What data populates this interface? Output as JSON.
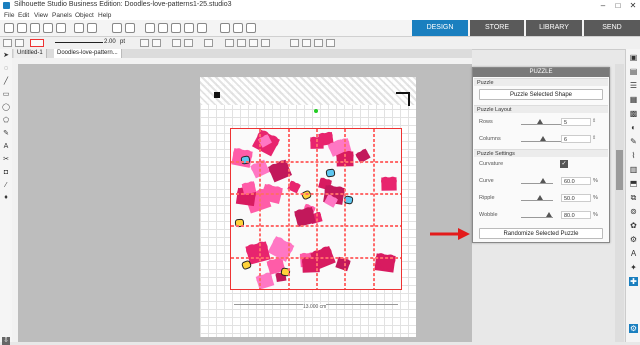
{
  "window": {
    "title": "Silhouette Studio Business Edition: Doodles-love-patterns1-25.studio3"
  },
  "menu": [
    "File",
    "Edit",
    "View",
    "Panels",
    "Object",
    "Help"
  ],
  "toolbar": {
    "line_width": "2.00",
    "line_unit": "pt"
  },
  "nav_tabs": [
    {
      "label": "DESIGN",
      "color": "#1a7fbf"
    },
    {
      "label": "STORE",
      "color": "#5a5a5a"
    },
    {
      "label": "LIBRARY",
      "color": "#5a5a5a"
    },
    {
      "label": "SEND",
      "color": "#5a5a5a"
    }
  ],
  "doc_tabs": [
    "Untitled-1",
    "Doodles-love-pattern..."
  ],
  "canvas": {
    "dimension_label": "13.000 cm",
    "accent": "#e33333"
  },
  "panel": {
    "title": "PUZZLE",
    "puzzle_section": "Puzzle",
    "puzzle_button": "Puzzle Selected Shape",
    "layout_section": "Puzzle Layout",
    "rows_label": "Rows",
    "rows_value": "5",
    "columns_label": "Columns",
    "columns_value": "6",
    "settings_section": "Puzzle Settings",
    "curvature_label": "Curvature",
    "curve_label": "Curve",
    "curve_value": "60.0",
    "ripple_label": "Ripple",
    "ripple_value": "50.0",
    "wobble_label": "Wobble",
    "wobble_value": "80.0",
    "unit": "%",
    "randomize_button": "Randomize Selected Puzzle"
  }
}
